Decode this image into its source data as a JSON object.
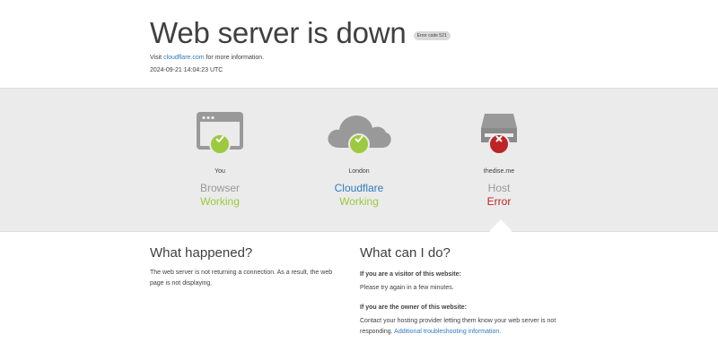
{
  "header": {
    "title": "Web server is down",
    "error_badge": "Error code 521",
    "visit_prefix": "Visit",
    "visit_link": "cloudflare.com",
    "visit_suffix": "for more information.",
    "timestamp": "2024-09-21 14:04:23 UTC"
  },
  "status": [
    {
      "location": "You",
      "label": "Browser",
      "state": "Working",
      "icon": "browser-icon",
      "result": "check-icon"
    },
    {
      "location": "London",
      "label": "Cloudflare",
      "state": "Working",
      "icon": "cloud-icon",
      "result": "check-icon"
    },
    {
      "location": "thedise.me",
      "label": "Host",
      "state": "Error",
      "icon": "server-icon",
      "result": "x-icon"
    }
  ],
  "what_happened": {
    "heading": "What happened?",
    "text": "The web server is not returning a connection. As a result, the web page is not displaying."
  },
  "what_can_i_do": {
    "heading": "What can I do?",
    "visitor_heading": "If you are a visitor of this website:",
    "visitor_text": "Please try again in a few minutes.",
    "owner_heading": "If you are the owner of this website:",
    "owner_text": "Contact your hosting provider letting them know your web server is not responding.",
    "owner_link": "Additional troubleshooting information."
  },
  "colors": {
    "ok": "#9bca3e",
    "error": "#bd2426",
    "link": "#2f7bbf",
    "band": "#ebebeb",
    "icon_gray": "#999999"
  }
}
